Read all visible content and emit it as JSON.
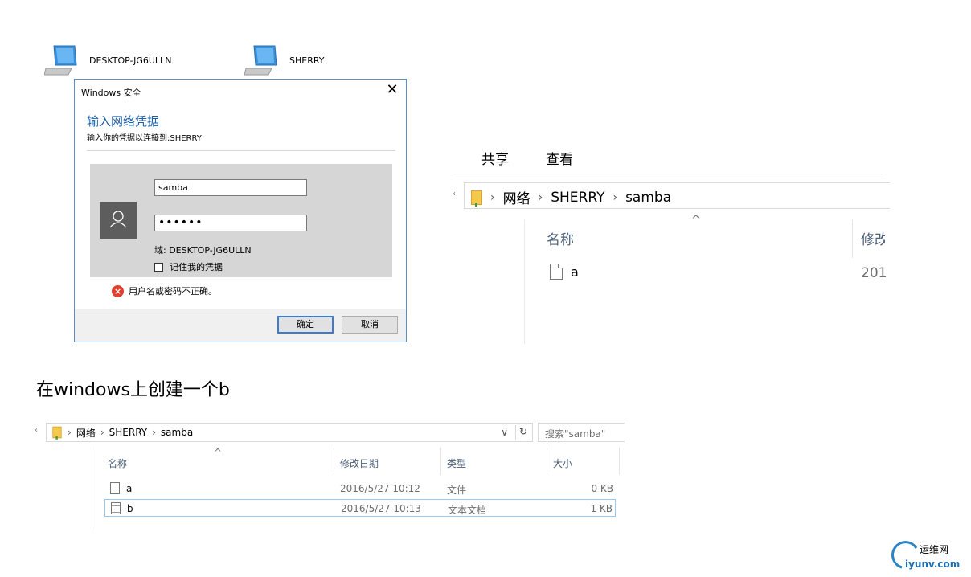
{
  "network": {
    "computers": [
      {
        "name": "DESKTOP-JG6ULLN",
        "icon": "computer-icon"
      },
      {
        "name": "SHERRY",
        "icon": "computer-icon"
      }
    ]
  },
  "dialog": {
    "title": "Windows 安全",
    "close": "✕",
    "heading": "输入网络凭据",
    "subheading": "输入你的凭据以连接到:SHERRY",
    "username": "samba",
    "password": "••••••",
    "domain": "域: DESKTOP-JG6ULLN",
    "remember_label": "记住我的凭据",
    "remember_checked": false,
    "error": "用户名或密码不正确。",
    "ok_label": "确定",
    "cancel_label": "取消",
    "accent": "#1b5fa8",
    "error_color": "#e0402f"
  },
  "explorer1": {
    "tabs": [
      "共享",
      "查看"
    ],
    "breadcrumb": [
      "网络",
      "SHERRY",
      "samba"
    ],
    "columns": {
      "name": "名称",
      "modified_partial": "修改"
    },
    "sort_indicator": "^",
    "files": [
      {
        "name": "a",
        "date_partial": "201"
      }
    ]
  },
  "caption": "在windows上创建一个b",
  "explorer2": {
    "breadcrumb": [
      "网络",
      "SHERRY",
      "samba"
    ],
    "dropdown": "∨",
    "refresh": "↻",
    "search_placeholder": "搜索\"samba\"",
    "sort_indicator": "^",
    "columns": {
      "name": "名称",
      "date": "修改日期",
      "type": "类型",
      "size": "大小"
    },
    "files": [
      {
        "name": "a",
        "date": "2016/5/27 10:12",
        "type": "文件",
        "size": "0 KB",
        "selected": false
      },
      {
        "name": "b",
        "date": "2016/5/27 10:13",
        "type": "文本文档",
        "size": "1 KB",
        "selected": true
      }
    ]
  },
  "watermark": {
    "cn": "运维网",
    "url": "iyunv.com"
  }
}
